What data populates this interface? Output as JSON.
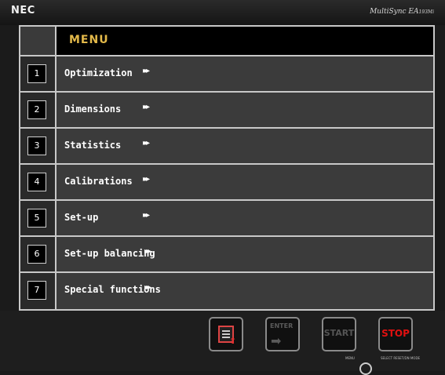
{
  "bezel": {
    "brand": "NEC",
    "model": "MultiSync EA",
    "model_suffix": "193Mi"
  },
  "menu": {
    "title": "MENU",
    "items": [
      {
        "num": "1",
        "label": "Optimization",
        "arrows": "▸▸▸"
      },
      {
        "num": "2",
        "label": "Dimensions",
        "arrows": "▸▸▸"
      },
      {
        "num": "3",
        "label": "Statistics",
        "arrows": "▸▸▸"
      },
      {
        "num": "4",
        "label": "Calibrations",
        "arrows": "▸▸▸"
      },
      {
        "num": "5",
        "label": "Set-up",
        "arrows": "▸▸▸"
      },
      {
        "num": "6",
        "label": "Set-up balancing",
        "arrows": "▸▸▸"
      },
      {
        "num": "7",
        "label": "Special functions",
        "arrows": "▸▸▸"
      }
    ]
  },
  "buttons": {
    "enter": "ENTER",
    "start": "START",
    "stop": "STOP"
  },
  "hardware": {
    "left_label": "MENU",
    "right_label": "SELECT  RESET/DN MODE"
  },
  "colors": {
    "title": "#e3b94a",
    "stop": "#e01010",
    "border": "#c8c8c8"
  }
}
